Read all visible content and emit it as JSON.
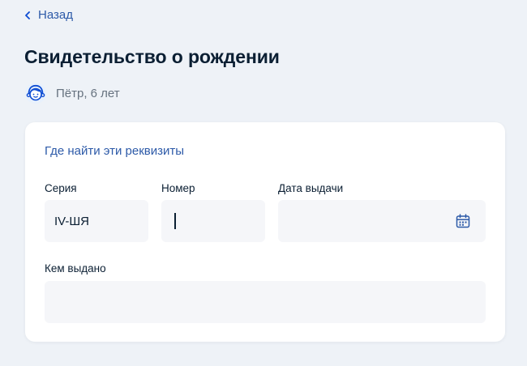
{
  "nav": {
    "back_label": "Назад"
  },
  "page": {
    "title": "Свидетельство о рождении"
  },
  "child": {
    "name": "Пётр, 6 лет"
  },
  "form": {
    "where_link": "Где найти эти реквизиты",
    "series": {
      "label": "Серия",
      "value": "IV-ШЯ"
    },
    "number": {
      "label": "Номер",
      "value": ""
    },
    "issue_date": {
      "label": "Дата выдачи",
      "value": "",
      "icon": "calendar-icon"
    },
    "issued_by": {
      "label": "Кем выдано",
      "value": ""
    }
  },
  "colors": {
    "accent": "#0d4cd3",
    "link": "#2d5aa8",
    "background": "#eef2f7",
    "field": "#f5f6f9",
    "text": "#0b1f33",
    "muted": "#66727f"
  }
}
